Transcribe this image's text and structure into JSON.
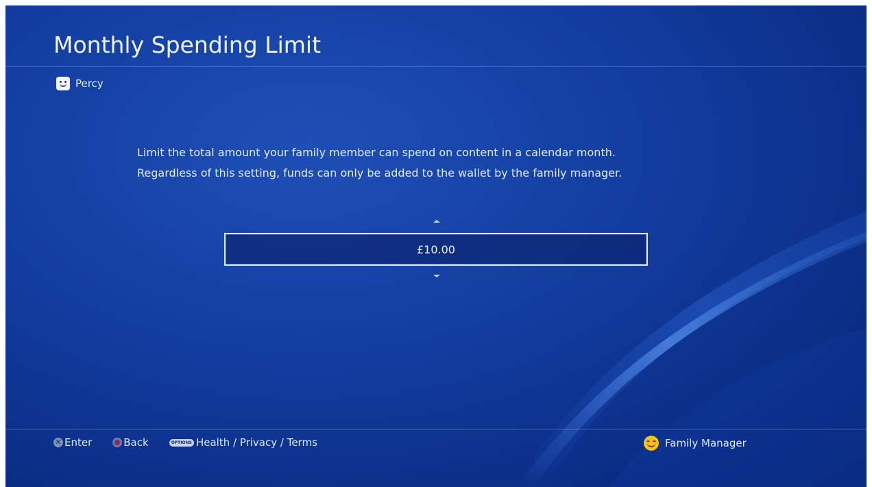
{
  "header": {
    "title": "Monthly Spending Limit",
    "user_name": "Percy"
  },
  "main": {
    "description_lines": [
      "Limit the total amount your family member can spend on content in a calendar month.",
      "Regardless of this setting, funds can only be added to the wallet by the family manager."
    ],
    "value": "£10.00"
  },
  "footer": {
    "enter": {
      "button": "✕",
      "label": "Enter"
    },
    "back": {
      "label": "Back"
    },
    "options": {
      "button": "OPTIONS",
      "label": "Health / Privacy / Terms"
    },
    "manager_label": "Family Manager"
  },
  "icons": {
    "user_avatar": "smiley-avatar-icon",
    "manager_avatar": "smiley-face-icon",
    "up": "chevron-up-icon",
    "down": "chevron-down-icon",
    "cross_button": "cross-button-icon",
    "circle_button": "circle-button-icon",
    "options_button": "options-button-icon"
  },
  "colors": {
    "background": "#123c9f",
    "text": "#e4ebff",
    "manager_avatar": "#f3c21b"
  }
}
